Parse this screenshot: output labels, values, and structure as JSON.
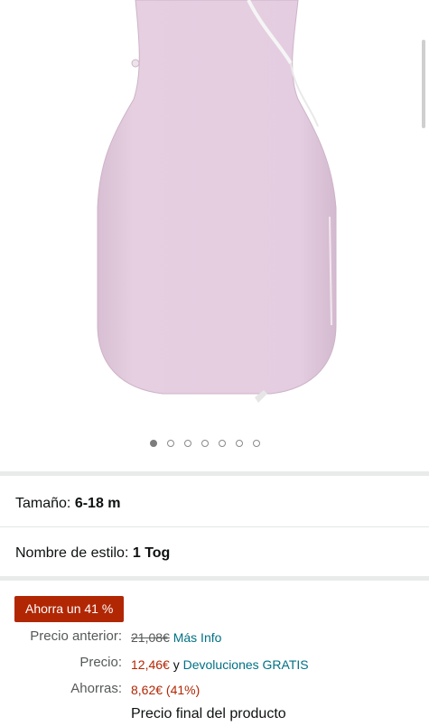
{
  "gallery": {
    "image_alt": "product-sleeping-bag-lilac",
    "dot_count": 7,
    "active_index": 0
  },
  "size": {
    "label": "Tamaño:",
    "value": "6-18 m"
  },
  "style": {
    "label": "Nombre de estilo:",
    "value": "1 Tog"
  },
  "deal_badge": "Ahorra un 41 %",
  "pricing": {
    "previous_label": "Precio anterior:",
    "previous_value": "21,08€",
    "more_info": "Más Info",
    "price_label": "Precio:",
    "price_value": "12,46€",
    "and_text": "y",
    "returns": "Devoluciones GRATIS",
    "savings_label": "Ahorras:",
    "savings_value": "8,62€ (41%)",
    "final_note": "Precio final del producto"
  },
  "colors": {
    "accent_red": "#b12704",
    "link": "#007185",
    "product": "#e3c9dc"
  }
}
